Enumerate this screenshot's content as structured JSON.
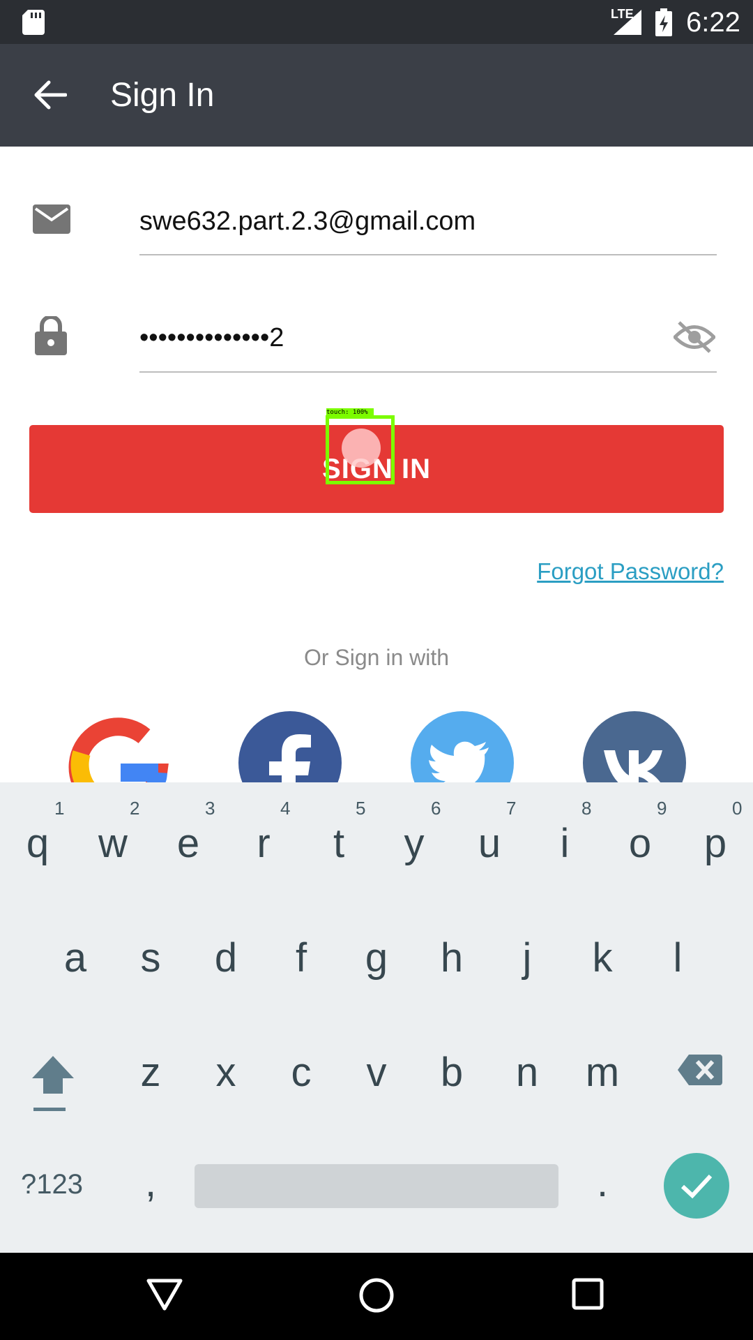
{
  "status_bar": {
    "time": "6:22",
    "network": "LTE"
  },
  "app_bar": {
    "title": "Sign In",
    "back_icon": "arrow-back-icon"
  },
  "form": {
    "email_value": "swe632.part.2.3@gmail.com",
    "password_value": "••••••••••••••2",
    "sign_in_label": "SIGN IN",
    "forgot_password_label": "Forgot Password?",
    "or_sign_in_with": "Or Sign in with"
  },
  "social": [
    "google-icon",
    "facebook-icon",
    "twitter-icon",
    "vk-icon"
  ],
  "touch_overlay": {
    "label": "touch: 100%"
  },
  "keyboard": {
    "row1_hints": [
      "1",
      "2",
      "3",
      "4",
      "5",
      "6",
      "7",
      "8",
      "9",
      "0"
    ],
    "row1": [
      "q",
      "w",
      "e",
      "r",
      "t",
      "y",
      "u",
      "i",
      "o",
      "p"
    ],
    "row2": [
      "a",
      "s",
      "d",
      "f",
      "g",
      "h",
      "j",
      "k",
      "l"
    ],
    "row3": [
      "z",
      "x",
      "c",
      "v",
      "b",
      "n",
      "m"
    ],
    "symbols_label": "?123",
    "comma": ",",
    "period": "."
  },
  "colors": {
    "accent": "#e53935",
    "link": "#2b9ec3",
    "appbar": "#3b3f47",
    "done": "#4db6ac"
  }
}
